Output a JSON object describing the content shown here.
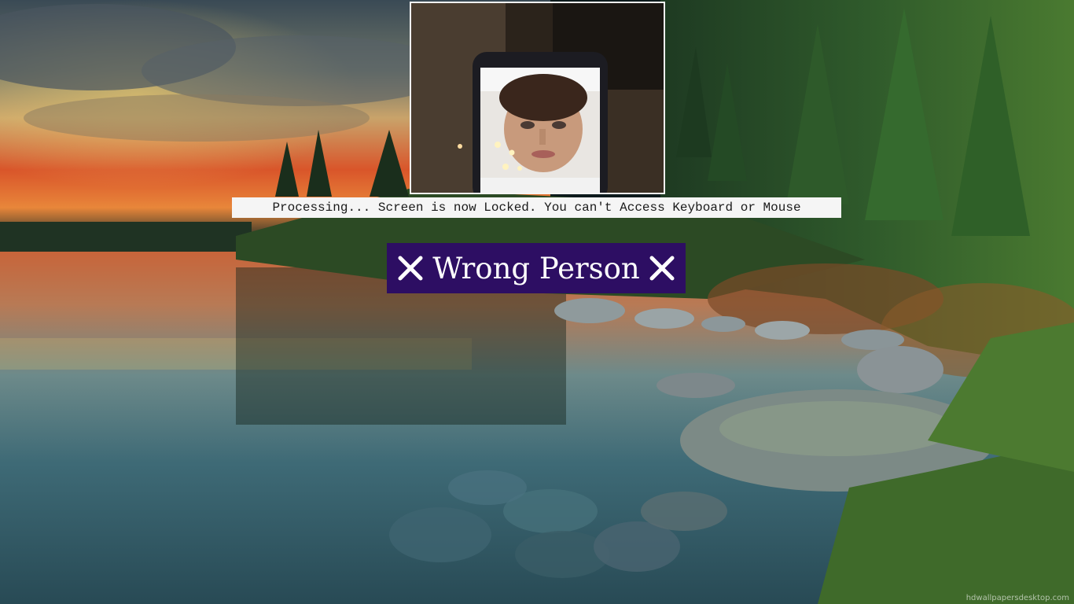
{
  "lock_screen": {
    "status_message": "Processing... Screen is now Locked. You can't Access Keyboard or Mouse",
    "result_text": "Wrong Person",
    "result_icon": "cross-mark-icon",
    "result_bg_color": "#2d0e63",
    "camera_preview_icon": "webcam-preview"
  },
  "wallpaper": {
    "scene": "lake-forest-sunset",
    "watermark": "hdwallpapersdesktop.com"
  }
}
